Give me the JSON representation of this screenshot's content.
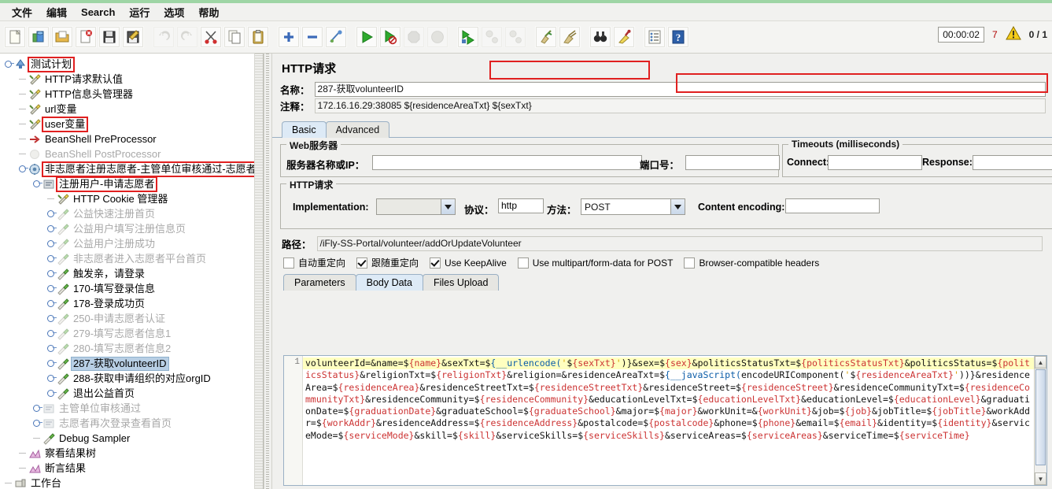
{
  "window": {
    "title": "HTTP请求"
  },
  "menubar": {
    "items": [
      "文件",
      "编辑",
      "Search",
      "运行",
      "选项",
      "帮助"
    ]
  },
  "toolbar": {
    "buttons": [
      {
        "name": "new",
        "icon": "new-file-icon"
      },
      {
        "name": "templates",
        "icon": "templates-icon"
      },
      {
        "name": "open",
        "icon": "open-folder-icon"
      },
      {
        "name": "close",
        "icon": "close-file-icon"
      },
      {
        "name": "save",
        "icon": "save-disk-icon"
      },
      {
        "name": "save-as",
        "icon": "save-as-icon"
      },
      {
        "name": "undo",
        "icon": "undo-arrow-icon"
      },
      {
        "name": "redo",
        "icon": "redo-arrow-icon"
      },
      {
        "name": "cut",
        "icon": "scissors-icon"
      },
      {
        "name": "copy",
        "icon": "copy-icon"
      },
      {
        "name": "paste",
        "icon": "clipboard-paste-icon"
      },
      {
        "name": "expand-all",
        "icon": "plus-icon"
      },
      {
        "name": "collapse-all",
        "icon": "minus-icon"
      },
      {
        "name": "toggle",
        "icon": "toggle-icon"
      },
      {
        "name": "start",
        "icon": "play-green-icon"
      },
      {
        "name": "start-no-pauses",
        "icon": "play-no-pause-icon"
      },
      {
        "name": "stop",
        "icon": "stop-icon"
      },
      {
        "name": "shutdown",
        "icon": "shutdown-icon"
      },
      {
        "name": "start-remote-all",
        "icon": "remote-start-icon"
      },
      {
        "name": "stop-remote-all",
        "icon": "remote-stop-icon"
      },
      {
        "name": "shutdown-remote-all",
        "icon": "remote-shutdown-icon"
      },
      {
        "name": "clear",
        "icon": "clear-broom-icon"
      },
      {
        "name": "clear-all",
        "icon": "clear-all-icon"
      },
      {
        "name": "search",
        "icon": "binoculars-icon"
      },
      {
        "name": "reset-search",
        "icon": "reset-search-icon"
      },
      {
        "name": "function-helper",
        "icon": "function-helper-icon"
      },
      {
        "name": "help",
        "icon": "help-book-icon"
      }
    ]
  },
  "status": {
    "timer": "00:00:02",
    "warnings": "7",
    "warn_icon": "warning-triangle-icon",
    "threads": "0 / 1"
  },
  "tree": {
    "nodes": [
      {
        "label": "测试计划",
        "depth": 0,
        "icon": "test-plan-icon",
        "dim": false,
        "expandable": true,
        "highlight": true
      },
      {
        "label": "HTTP请求默认值",
        "depth": 1,
        "icon": "config-element-icon",
        "dim": false,
        "expandable": false
      },
      {
        "label": "HTTP信息头管理器",
        "depth": 1,
        "icon": "config-element-icon",
        "dim": false,
        "expandable": false
      },
      {
        "label": "url变量",
        "depth": 1,
        "icon": "config-element-icon",
        "dim": false,
        "expandable": false
      },
      {
        "label": "user变量",
        "depth": 1,
        "icon": "config-element-icon",
        "dim": false,
        "expandable": false,
        "highlight": true
      },
      {
        "label": "BeanShell PreProcessor",
        "depth": 1,
        "icon": "preprocessor-icon",
        "dim": false,
        "expandable": false
      },
      {
        "label": "BeanShell PostProcessor",
        "depth": 1,
        "icon": "postprocessor-icon",
        "dim": true,
        "expandable": false
      },
      {
        "label": "非志愿者注册志愿者-主管单位审核通过-志愿者再次",
        "depth": 1,
        "icon": "thread-group-icon",
        "dim": false,
        "expandable": true,
        "highlight": true
      },
      {
        "label": "注册用户-申请志愿者",
        "depth": 2,
        "icon": "controller-icon",
        "dim": false,
        "expandable": true,
        "highlight": true
      },
      {
        "label": "HTTP Cookie 管理器",
        "depth": 3,
        "icon": "config-element-icon",
        "dim": false,
        "expandable": false
      },
      {
        "label": "公益快速注册首页",
        "depth": 3,
        "icon": "http-sampler-icon",
        "dim": true,
        "expandable": true
      },
      {
        "label": "公益用户填写注册信息页",
        "depth": 3,
        "icon": "http-sampler-icon",
        "dim": true,
        "expandable": true
      },
      {
        "label": "公益用户注册成功",
        "depth": 3,
        "icon": "http-sampler-icon",
        "dim": true,
        "expandable": true
      },
      {
        "label": "非志愿者进入志愿者平台首页",
        "depth": 3,
        "icon": "http-sampler-icon",
        "dim": true,
        "expandable": true
      },
      {
        "label": "触发亲，请登录",
        "depth": 3,
        "icon": "http-sampler-icon",
        "dim": false,
        "expandable": true
      },
      {
        "label": "170-填写登录信息",
        "depth": 3,
        "icon": "http-sampler-icon",
        "dim": false,
        "expandable": true
      },
      {
        "label": "178-登录成功页",
        "depth": 3,
        "icon": "http-sampler-icon",
        "dim": false,
        "expandable": true
      },
      {
        "label": "250-申请志愿者认证",
        "depth": 3,
        "icon": "http-sampler-icon",
        "dim": true,
        "expandable": true
      },
      {
        "label": "279-填写志愿者信息1",
        "depth": 3,
        "icon": "http-sampler-icon",
        "dim": true,
        "expandable": true
      },
      {
        "label": "280-填写志愿者信息2",
        "depth": 3,
        "icon": "http-sampler-icon",
        "dim": true,
        "expandable": true
      },
      {
        "label": "287-获取volunteerID",
        "depth": 3,
        "icon": "http-sampler-icon",
        "dim": false,
        "expandable": true,
        "selected": true,
        "highlight": true
      },
      {
        "label": "288-获取申请组织的对应orgID",
        "depth": 3,
        "icon": "http-sampler-icon",
        "dim": false,
        "expandable": true
      },
      {
        "label": "退出公益首页",
        "depth": 3,
        "icon": "http-sampler-icon",
        "dim": false,
        "expandable": true
      },
      {
        "label": "主管单位审核通过",
        "depth": 2,
        "icon": "controller-icon",
        "dim": true,
        "expandable": true
      },
      {
        "label": "志愿者再次登录查看首页",
        "depth": 2,
        "icon": "controller-icon",
        "dim": true,
        "expandable": true
      },
      {
        "label": "Debug Sampler",
        "depth": 2,
        "icon": "http-sampler-icon",
        "dim": false,
        "expandable": false
      },
      {
        "label": "察看结果树",
        "depth": 1,
        "icon": "listener-icon",
        "dim": false,
        "expandable": false
      },
      {
        "label": "断言结果",
        "depth": 1,
        "icon": "listener-icon",
        "dim": false,
        "expandable": false
      },
      {
        "label": "工作台",
        "depth": 0,
        "icon": "workbench-icon",
        "dim": false,
        "expandable": false
      }
    ]
  },
  "panel": {
    "title": "HTTP请求",
    "name_label": "名称：",
    "name_value": "287-获取volunteerID",
    "comment_label": "注释：",
    "comment_value": "172.16.16.29:38085  ${residenceAreaTxt} ${sexTxt}",
    "tabs": [
      {
        "label": "Basic",
        "active": true
      },
      {
        "label": "Advanced",
        "active": false
      }
    ],
    "web_server": {
      "group_title": "Web服务器",
      "server_label": "服务器名称或IP：",
      "server_value": "",
      "port_label": "端口号：",
      "port_value": ""
    },
    "timeouts": {
      "group_title": "Timeouts (milliseconds)",
      "connect_label": "Connect:",
      "connect_value": "",
      "response_label": "Response:",
      "response_value": ""
    },
    "http_request": {
      "group_title": "HTTP请求",
      "implementation_label": "Implementation:",
      "implementation_value": "",
      "protocol_label": "协议：",
      "protocol_value": "http",
      "method_label": "方法：",
      "method_value": "POST",
      "content_encoding_label": "Content encoding:",
      "content_encoding_value": ""
    },
    "path_label": "路径：",
    "path_value": "/iFly-SS-Portal/volunteer/addOrUpdateVolunteer",
    "checkboxes": [
      {
        "label": "自动重定向",
        "checked": false
      },
      {
        "label": "跟随重定向",
        "checked": true
      },
      {
        "label": "Use KeepAlive",
        "checked": true
      },
      {
        "label": "Use multipart/form-data for POST",
        "checked": false
      },
      {
        "label": "Browser-compatible headers",
        "checked": false
      }
    ],
    "data_tabs": [
      {
        "label": "Parameters",
        "active": false
      },
      {
        "label": "Body Data",
        "active": true
      },
      {
        "label": "Files Upload",
        "active": false
      }
    ],
    "editor": {
      "line_number": "1",
      "body": "volunteerId=&name=${name}&sexTxt=${__urlencode('${sexTxt}')}&sex=${sex}&politicsStatusTxt=${politicsStatusTxt}&politicsStatus=${politicsStatus}&religionTxt=${religionTxt}&religion=&residenceAreaTxt=${__javaScript(encodeURIComponent('${residenceAreaTxt}'))}&residenceArea=${residenceArea}&residenceStreetTxt=${residenceStreetTxt}&residenceStreet=${residenceStreet}&residenceCommunityTxt=${residenceCommunityTxt}&residenceCommunity=${residenceCommunity}&educationLevelTxt=${educationLevelTxt}&educationLevel=${educationLevel}&graduationDate=${graduationDate}&graduateSchool=${graduateSchool}&major=${major}&workUnit=&{workUnit}&job=${job}&jobTitle=${jobTitle}&workAddr=${workAddr}&residenceAddress=${residenceAddress}&postalcode=${postalcode}&phone=${phone}&email=${email}&identity=${identity}&serviceMode=${serviceMode}&skill=${skill}&serviceSkills=${serviceSkills}&serviceAreas=${serviceAreas}&serviceTime=${serviceTime}"
    }
  },
  "colors": {
    "annotation": "#e02020",
    "selection": "#b8cfe5",
    "highlight_line": "#ffffc0"
  }
}
